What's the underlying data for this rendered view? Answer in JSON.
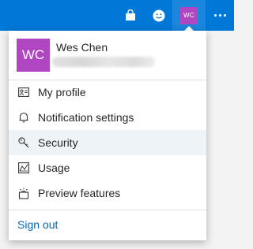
{
  "topbar": {
    "icons": [
      "store-icon",
      "smile-feedback-icon",
      "account-avatar",
      "more-icon"
    ],
    "avatar_initials": "WC",
    "color": "#0078d7"
  },
  "account": {
    "initials": "WC",
    "name": "Wes Chen",
    "avatar_color": "#b146c2"
  },
  "menu": {
    "items": [
      {
        "label": "My profile",
        "icon": "contact-card-icon"
      },
      {
        "label": "Notification settings",
        "icon": "bell-icon"
      },
      {
        "label": "Security",
        "icon": "key-icon"
      },
      {
        "label": "Usage",
        "icon": "usage-icon"
      },
      {
        "label": "Preview features",
        "icon": "preview-features-icon"
      }
    ],
    "hovered_item": "Security"
  },
  "signout_label": "Sign out",
  "colors": {
    "link": "#0067b8",
    "hover": "#eef3f8"
  }
}
